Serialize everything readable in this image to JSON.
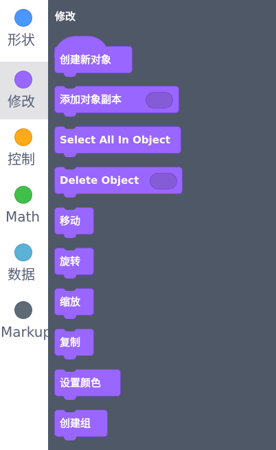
{
  "categories": [
    {
      "label": "形状",
      "color": "#4c97ff"
    },
    {
      "label": "修改",
      "color": "#9966ff"
    },
    {
      "label": "控制",
      "color": "#ffab19"
    },
    {
      "label": "Math",
      "color": "#40bf4a"
    },
    {
      "label": "数据",
      "color": "#5cb1d6"
    },
    {
      "label": "Markup",
      "color": "#5f6a77"
    }
  ],
  "flyout": {
    "title": "修改",
    "blocks": [
      {
        "label": "创建新对象"
      },
      {
        "label": "添加对象副本"
      },
      {
        "label": "Select All In Object"
      },
      {
        "label": "Delete Object"
      },
      {
        "label": "移动"
      },
      {
        "label": "旋转"
      },
      {
        "label": "缩放"
      },
      {
        "label": "复制"
      },
      {
        "label": "设置颜色"
      },
      {
        "label": "创建组"
      }
    ]
  }
}
